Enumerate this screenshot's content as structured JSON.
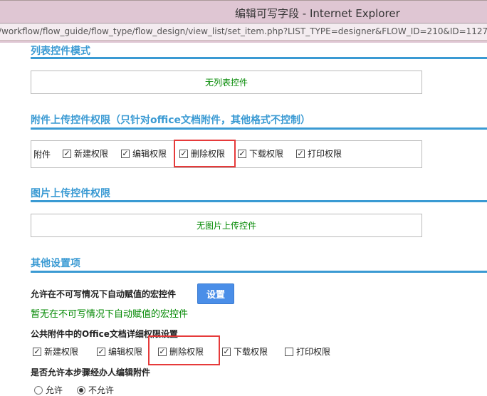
{
  "window": {
    "title": "编辑可写字段 - Internet Explorer",
    "url": "/workflow/flow_guide/flow_type/flow_design/view_list/set_item.php?LIST_TYPE=designer&FLOW_ID=210&ID=1127"
  },
  "list_section": {
    "heading": "列表控件模式",
    "empty": "无列表控件"
  },
  "attach_section": {
    "heading": "附件上传控件权限（只针对office文档附件，其他格式不控制）",
    "label": "附件",
    "perms": [
      {
        "label": "新建权限",
        "checked": true
      },
      {
        "label": "编辑权限",
        "checked": true
      },
      {
        "label": "删除权限",
        "checked": true
      },
      {
        "label": "下载权限",
        "checked": true
      },
      {
        "label": "打印权限",
        "checked": true
      }
    ]
  },
  "image_section": {
    "heading": "图片上传控件权限",
    "empty": "无图片上传控件"
  },
  "other_section": {
    "heading": "其他设置项",
    "macro_label": "允许在不可写情况下自动赋值的宏控件",
    "set_button": "设置",
    "macro_empty": "暂无在不可写情况下自动赋值的宏控件",
    "office_label": "公共附件中的Office文档详细权限设置",
    "perms": [
      {
        "label": "新建权限",
        "checked": true
      },
      {
        "label": "编辑权限",
        "checked": true
      },
      {
        "label": "删除权限",
        "checked": true
      },
      {
        "label": "下载权限",
        "checked": true
      },
      {
        "label": "打印权限",
        "checked": false
      }
    ],
    "edit_label": "是否允许本步骤经办人编辑附件",
    "radios": [
      {
        "label": "允许",
        "selected": false
      },
      {
        "label": "不允许",
        "selected": true
      }
    ]
  },
  "highlight_color": "#e63a3a"
}
